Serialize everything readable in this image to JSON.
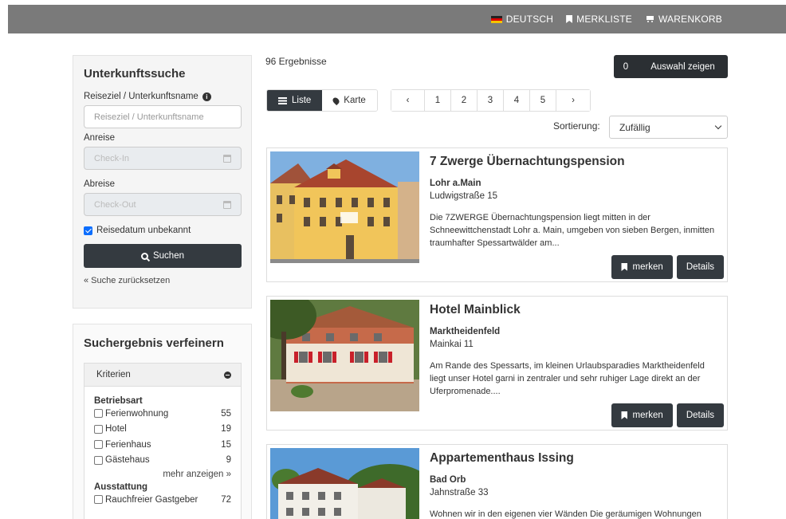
{
  "topnav": {
    "language": "DEUTSCH",
    "watchlist": "MERKLISTE",
    "cart": "WARENKORB"
  },
  "search": {
    "title": "Unterkunftssuche",
    "destination_label": "Reiseziel / Unterkunftsname",
    "destination_placeholder": "Reiseziel / Unterkunftsname",
    "arrival_label": "Anreise",
    "arrival_placeholder": "Check-In",
    "departure_label": "Abreise",
    "departure_placeholder": "Check-Out",
    "date_unknown_label": "Reisedatum unbekannt",
    "date_unknown_checked": true,
    "search_button": "Suchen",
    "reset_link": "« Suche zurücksetzen"
  },
  "refine": {
    "title": "Suchergebnis verfeinern",
    "criteria_header": "Kriterien",
    "groups": [
      {
        "title": "Betriebsart",
        "items": [
          {
            "label": "Ferienwohnung",
            "count": "55"
          },
          {
            "label": "Hotel",
            "count": "19"
          },
          {
            "label": "Ferienhaus",
            "count": "15"
          },
          {
            "label": "Gästehaus",
            "count": "9"
          }
        ],
        "more": "mehr anzeigen »"
      },
      {
        "title": "Ausstattung",
        "items": [
          {
            "label": "Rauchfreier Gastgeber",
            "count": "72"
          }
        ]
      }
    ]
  },
  "results": {
    "count_text": "96 Ergebnisse",
    "selection_count": "0",
    "selection_button": "Auswahl zeigen",
    "view_list": "Liste",
    "view_map": "Karte",
    "pages": [
      "‹",
      "1",
      "2",
      "3",
      "4",
      "5",
      "›"
    ],
    "sort_label": "Sortierung:",
    "sort_value": "Zufällig",
    "cards": [
      {
        "title": "7 Zwerge Übernachtungspension",
        "city": "Lohr a.Main",
        "street": "Ludwigstraße 15",
        "description": "Die 7ZWERGE Übernachtungspension liegt mitten in der Schneewittchenstadt Lohr a. Main, umgeben von sieben Bergen, inmitten traumhafter Spessartwälder am...",
        "save": "merken",
        "details": "Details"
      },
      {
        "title": "Hotel Mainblick",
        "city": "Marktheidenfeld",
        "street": "Mainkai 11",
        "description": "Am Rande des Spessarts, im kleinen Urlaubsparadies Marktheidenfeld liegt unser Hotel garni in zentraler und sehr ruhiger Lage direkt an der Uferpromenade....",
        "save": "merken",
        "details": "Details"
      },
      {
        "title": "Appartementhaus Issing",
        "city": "Bad Orb",
        "street": "Jahnstraße 33",
        "description": "Wohnen wir in den eigenen vier Wänden Die geräumigen Wohnungen"
      }
    ]
  },
  "colors": {
    "topbar": "#7a7a7a",
    "dark_button": "#343a40",
    "checkbox": "#0d6efd"
  }
}
